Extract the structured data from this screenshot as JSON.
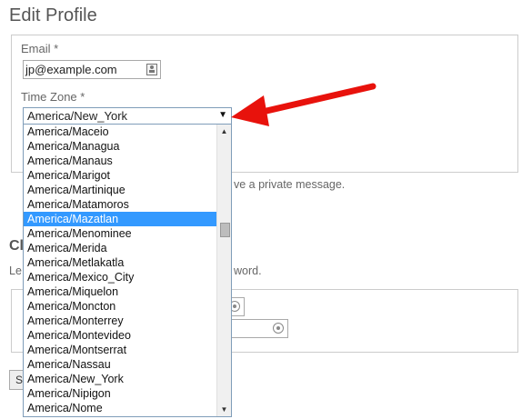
{
  "page": {
    "title": "Edit Profile"
  },
  "email": {
    "label": "Email",
    "required_mark": "*",
    "value": "jp@example.com"
  },
  "timezone": {
    "label": "Time Zone",
    "required_mark": "*",
    "selected": "America/New_York",
    "highlighted": "America/Mazatlan",
    "options": [
      "America/Maceio",
      "America/Managua",
      "America/Manaus",
      "America/Marigot",
      "America/Martinique",
      "America/Matamoros",
      "America/Mazatlan",
      "America/Menominee",
      "America/Merida",
      "America/Metlakatla",
      "America/Mexico_City",
      "America/Miquelon",
      "America/Moncton",
      "America/Monterrey",
      "America/Montevideo",
      "America/Montserrat",
      "America/Nassau",
      "America/New_York",
      "America/Nipigon",
      "America/Nome"
    ]
  },
  "background": {
    "private_message_fragment": "ve a private message.",
    "section_heading_fragment": "Cl",
    "password_hint_prefix": "Le",
    "password_hint_fragment": "word.",
    "submit_fragment": "S"
  },
  "colors": {
    "highlight": "#3399ff",
    "arrow": "#e8120c"
  }
}
